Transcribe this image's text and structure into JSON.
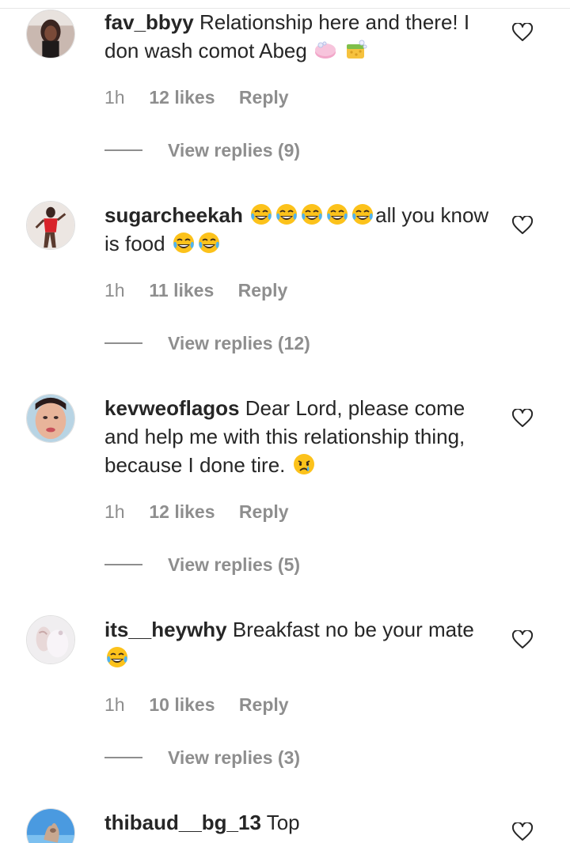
{
  "comments": [
    {
      "username": "fav_bbyy",
      "text": " Relationship here and there! I don wash comot Abeg ",
      "emojis": [
        "soap-emoji",
        "sponge-emoji"
      ],
      "time": "1h",
      "likes": "12 likes",
      "reply": "Reply",
      "view_replies": "View replies (9)"
    },
    {
      "username": "sugarcheekah",
      "text_a": "all you know is food ",
      "emojis_a": [
        "tears-of-joy-emoji",
        "tears-of-joy-emoji",
        "tears-of-joy-emoji",
        "tears-of-joy-emoji",
        "tears-of-joy-emoji"
      ],
      "emojis_b": [
        "tears-of-joy-emoji",
        "tears-of-joy-emoji"
      ],
      "time": "1h",
      "likes": "11 likes",
      "reply": "Reply",
      "view_replies": "View replies (12)"
    },
    {
      "username": "kevweoflagos",
      "text": " Dear Lord, please come and help me with this relationship thing, because I done tire. ",
      "emojis": [
        "crying-face-emoji"
      ],
      "time": "1h",
      "likes": "12 likes",
      "reply": "Reply",
      "view_replies": "View replies (5)"
    },
    {
      "username": "its__heywhy",
      "text": " Breakfast no be your mate ",
      "emojis": [
        "tears-of-joy-emoji"
      ],
      "time": "1h",
      "likes": "10 likes",
      "reply": "Reply",
      "view_replies": "View replies (3)"
    },
    {
      "username": "thibaud__bg_13",
      "text": " Top"
    }
  ],
  "colors": {
    "text": "#262626",
    "meta": "#8e8e8e",
    "background": "#ffffff"
  },
  "icons": {
    "like": "heart-outline-icon"
  }
}
